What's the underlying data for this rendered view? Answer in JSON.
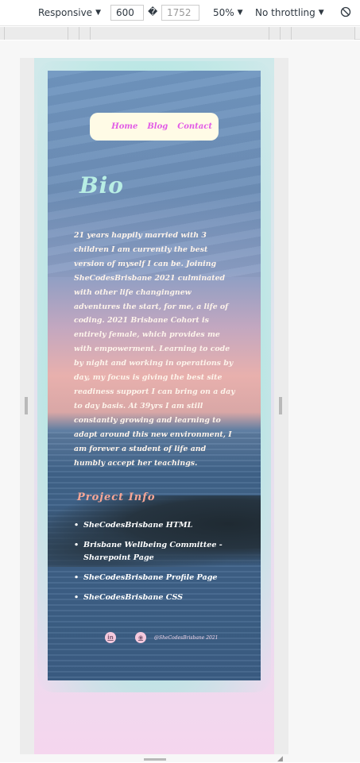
{
  "devtools": {
    "device": "Responsive",
    "width": "600",
    "times": "�",
    "height": "1752",
    "zoom": "50%",
    "throttling": "No throttling",
    "rotate_icon": "rotate-icon"
  },
  "site": {
    "nav": [
      "Home",
      "Blog",
      "Contact"
    ],
    "bio_title": "Bio",
    "bio_text": "21 years happily married with 3 children I am currently the best version of myself I can be. Joining SheCodesBrisbane 2021 culminated with other life changingnew adventures the start, for me, a life of coding. 2021 Brisbane Cohort is entirely female, which provides me with empowerment. Learning to code by night and working in operations by day, my focus is giving the best site readiness support I can bring on a day to day basis. At 39yrs I am still constantly growing and learning to adapt around this new environment, I am forever a student of life and humbly accept her teachings.",
    "project_title": "Project Info",
    "projects": [
      "SheCodesBrisbane HTML",
      "Brisbane Wellbeing Committee - Sharepoint Page",
      "SheCodesBrisbane Profile Page",
      "SheCodesBrisbane CSS"
    ],
    "bullet": "•",
    "linkedin_glyph": "in",
    "github_glyph": "◉",
    "footer_text": "@SheCodesBrisbane 2021"
  },
  "colors": {
    "nav_link": "#e25be6",
    "bio_title": "#b8eee4",
    "project_title": "#f7a696"
  }
}
